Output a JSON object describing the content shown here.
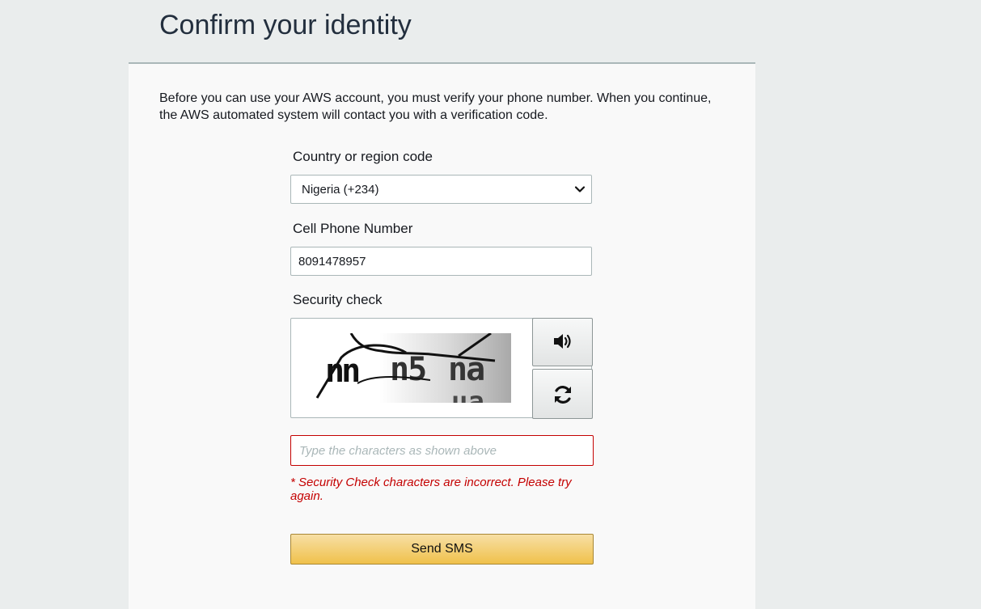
{
  "header": {
    "title": "Confirm your identity"
  },
  "intro": {
    "text": "Before you can use your AWS account, you must verify your phone number. When you continue, the AWS automated system will contact you with a verification code."
  },
  "country": {
    "label": "Country or region code",
    "selected": "Nigeria (+234)",
    "icon": "chevron-down-icon"
  },
  "phone": {
    "label": "Cell Phone Number",
    "value": "8091478957"
  },
  "security": {
    "label": "Security check",
    "captcha_text": "nn n5 na ua",
    "audio_icon": "speaker-icon",
    "refresh_icon": "refresh-icon",
    "input_placeholder": "Type the characters as shown above",
    "input_value": "",
    "error": "* Security Check characters are incorrect. Please try again."
  },
  "actions": {
    "send_label": "Send SMS"
  },
  "colors": {
    "background": "#eaeded",
    "panel": "#f9f9f9",
    "error": "#c40000",
    "button_top": "#f7dfa5",
    "button_bottom": "#f0c14b"
  }
}
